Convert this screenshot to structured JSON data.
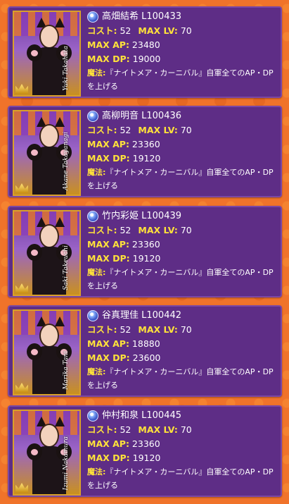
{
  "labels": {
    "cost": "コスト:",
    "max_lv": "MAX LV:",
    "max_ap": "MAX AP:",
    "max_dp": "MAX DP:",
    "magic": "魔法:"
  },
  "cards": [
    {
      "name": "高畑結希 L100433",
      "cost": "52",
      "max_lv": "70",
      "max_ap": "23480",
      "max_dp": "19000",
      "magic_line1": "『ナイトメア・カーニバル』自軍全てのAP・DP",
      "magic_line2": "を上げる",
      "signature": "Yuki Takahata"
    },
    {
      "name": "高柳明音 L100436",
      "cost": "52",
      "max_lv": "70",
      "max_ap": "23360",
      "max_dp": "19120",
      "magic_line1": "『ナイトメア・カーニバル』自軍全てのAP・DP",
      "magic_line2": "を上げる",
      "signature": "Akane Takayanagi"
    },
    {
      "name": "竹内彩姫 L100439",
      "cost": "52",
      "max_lv": "70",
      "max_ap": "23360",
      "max_dp": "19120",
      "magic_line1": "『ナイトメア・カーニバル』自軍全てのAP・DP",
      "magic_line2": "を上げる",
      "signature": "Saki Takeuchi"
    },
    {
      "name": "谷真理佳 L100442",
      "cost": "52",
      "max_lv": "70",
      "max_ap": "18880",
      "max_dp": "23600",
      "magic_line1": "『ナイトメア・カーニバル』自軍全てのAP・DP",
      "magic_line2": "を上げる",
      "signature": "Marika Tani"
    },
    {
      "name": "仲村和泉 L100445",
      "cost": "52",
      "max_lv": "70",
      "max_ap": "23360",
      "max_dp": "19120",
      "magic_line1": "『ナイトメア・カーニバル』自軍全てのAP・DP",
      "magic_line2": "を上げる",
      "signature": "Izumi Nakamura"
    }
  ],
  "icons": {
    "attribute": "blue-gem-icon"
  },
  "colors": {
    "background": "#f0732a",
    "card": "#5e2d86",
    "label": "#ffe23a",
    "text": "#ffffff",
    "frame": "#d9a02a"
  }
}
